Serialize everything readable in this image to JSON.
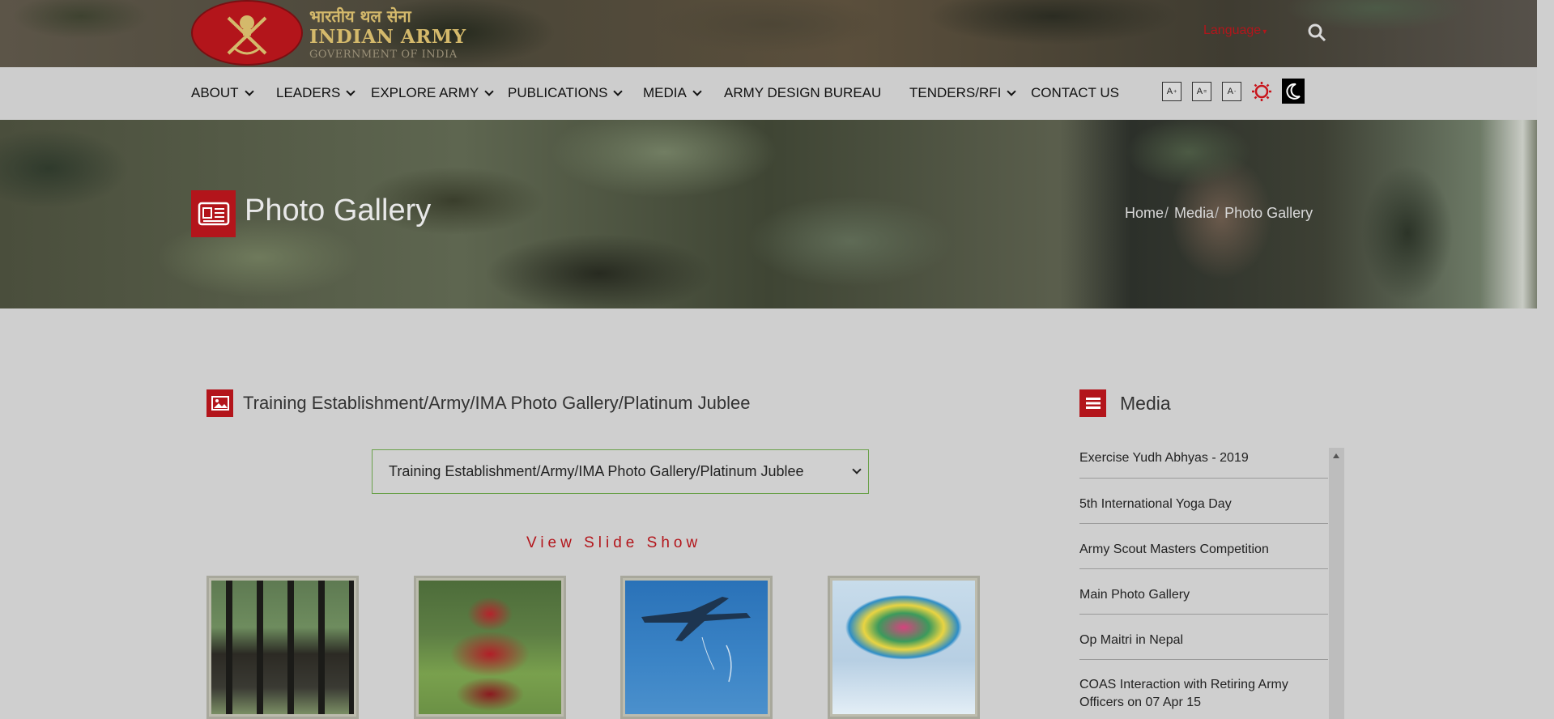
{
  "header": {
    "logo_hindi": "भारतीय थल सेना",
    "logo_english": "INDIAN ARMY",
    "logo_gov": "GOVERNMENT OF INDIA",
    "language_label": "Language",
    "search_icon": "search-icon"
  },
  "nav": {
    "items": [
      {
        "label": "ABOUT",
        "has_dropdown": true
      },
      {
        "label": "LEADERS",
        "has_dropdown": true
      },
      {
        "label": "EXPLORE ARMY",
        "has_dropdown": true
      },
      {
        "label": "PUBLICATIONS",
        "has_dropdown": true
      },
      {
        "label": "MEDIA",
        "has_dropdown": true
      },
      {
        "label": "ARMY DESIGN BUREAU",
        "has_dropdown": false
      },
      {
        "label": "TENDERS/RFI",
        "has_dropdown": true
      },
      {
        "label": "CONTACT US",
        "has_dropdown": false
      }
    ],
    "font_tools": {
      "increase": "A",
      "normal": "A",
      "decrease": "A",
      "inc_sup": "+",
      "norm_sup": "=",
      "dec_sup": "-"
    }
  },
  "hero": {
    "title": "Photo Gallery",
    "breadcrumb": {
      "home": "Home",
      "media": "Media",
      "current": "Photo Gallery",
      "separator": "/"
    }
  },
  "gallery": {
    "heading": "Training Establishment/Army/IMA Photo Gallery/Platinum Jublee",
    "selected_option": "Training Establishment/Army/IMA Photo Gallery/Platinum Jublee",
    "slideshow_label": "View Slide Show"
  },
  "sidebar": {
    "title": "Media",
    "items": [
      "Exercise Yudh Abhyas - 2019",
      "5th International Yoga Day",
      "Army Scout Masters Competition",
      "Main Photo Gallery",
      "Op Maitri in Nepal",
      "COAS Interaction with Retiring Army Officers on 07 Apr 15"
    ]
  },
  "colors": {
    "accent_red": "#b3151b",
    "logo_gold": "#d4b96b",
    "select_border": "#6aa14a",
    "page_bg": "#cfcfcf"
  }
}
